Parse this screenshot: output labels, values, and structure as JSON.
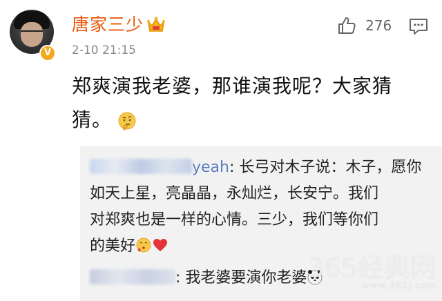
{
  "post": {
    "username": "唐家三少",
    "timestamp": "2-10 21:15",
    "like_count": "276",
    "text_line1": "郑爽演我老婆，那谁演我呢？大家猜",
    "text_line2": "猜。"
  },
  "reply1": {
    "name_suffix": "yeah",
    "text_lead": ": 长弓对木子说：木子，愿你",
    "text_l2": "如天上星，亮晶晶，永灿烂，长安宁。我们",
    "text_l3": "对郑爽也是一样的心情。三少，我们等你们",
    "text_l4": "的美好"
  },
  "reply2": {
    "text": ": 我老婆要演你老婆"
  },
  "watermark": {
    "main": "365经典网",
    "sub": "www.365J.com"
  },
  "icons": {
    "verify": "verified-badge-icon",
    "crown": "crown-icon",
    "like": "thumbs-up-icon",
    "comment": "comment-icon"
  },
  "colors": {
    "username": "#e8590c",
    "reply_bg": "#f2f2f2",
    "link": "#5b7fbf"
  }
}
